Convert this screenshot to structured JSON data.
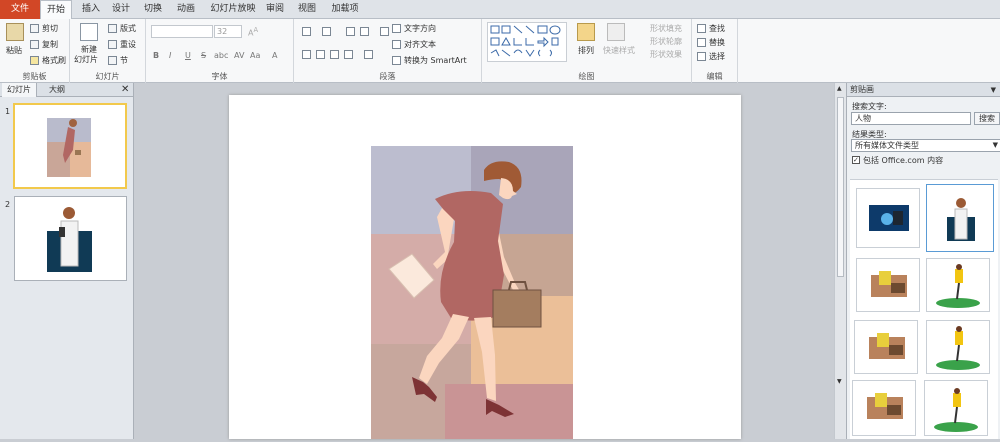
{
  "tabs": [
    "文件",
    "开始",
    "插入",
    "设计",
    "切换",
    "动画",
    "幻灯片放映",
    "审阅",
    "视图",
    "加载项"
  ],
  "clipboard": {
    "paste": "粘贴",
    "cut": "剪切",
    "copy": "复制",
    "format_painter": "格式刷",
    "label": "剪贴板"
  },
  "slides_group": {
    "new_slide_1": "新建",
    "new_slide_2": "幻灯片",
    "layout": "版式",
    "reset": "重设",
    "section": "节",
    "label": "幻灯片"
  },
  "font_group": {
    "size": "32",
    "label": "字体",
    "bold": "B",
    "italic": "I",
    "underline": "U",
    "strike": "S",
    "shadow": "abc",
    "case": "Aa"
  },
  "paragraph_group": {
    "text_direction": "文字方向",
    "align_text": "对齐文本",
    "smartart": "转换为 SmartArt",
    "label": "段落"
  },
  "drawing_group": {
    "arrange": "排列",
    "quick_styles": "快速样式",
    "shape_fill": "形状填充",
    "shape_outline": "形状轮廓",
    "shape_effects": "形状效果",
    "label": "绘图"
  },
  "editing_group": {
    "find": "查找",
    "replace": "替换",
    "select": "选择",
    "label": "编辑"
  },
  "thumb_tabs": [
    "幻灯片",
    "大纲"
  ],
  "slide_numbers": [
    "1",
    "2"
  ],
  "clip_panel": {
    "title": "剪贴画",
    "search_label": "搜索文字:",
    "search_value": "人物",
    "search_button": "搜索",
    "results_label": "结果类型:",
    "results_value": "所有媒体文件类型",
    "include_label": "包括 Office.com 内容"
  },
  "colors": {
    "file_tab": "#d24726",
    "ribbon": "#f7f8f9",
    "slide_bg": "#ffffff"
  }
}
